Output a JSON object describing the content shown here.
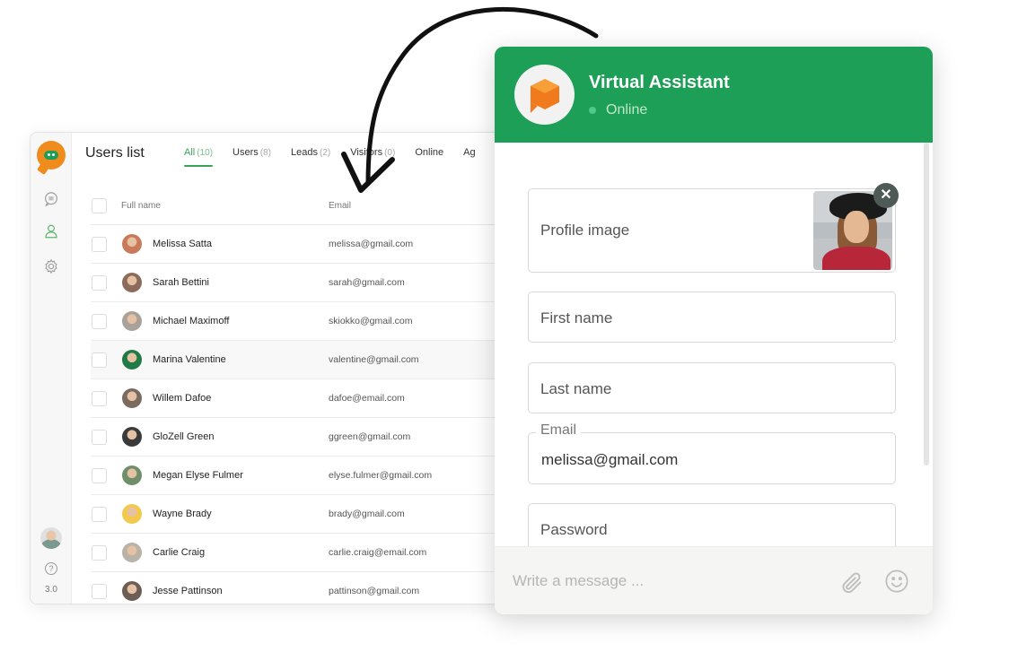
{
  "users_panel": {
    "title": "Users list",
    "version": "3.0",
    "help_glyph": "?",
    "rail_icons": [
      "app-logo-icon",
      "chat-icon",
      "user-icon",
      "gear-icon"
    ],
    "tabs": [
      {
        "label": "All",
        "count": "(10)",
        "active": true
      },
      {
        "label": "Users",
        "count": "(8)",
        "active": false
      },
      {
        "label": "Leads",
        "count": "(2)",
        "active": false
      },
      {
        "label": "Visitors",
        "count": "(0)",
        "active": false
      },
      {
        "label": "Online",
        "count": "",
        "active": false
      },
      {
        "label": "Ag",
        "count": "",
        "active": false
      }
    ],
    "columns": {
      "name": "Full name",
      "email": "Email"
    },
    "rows": [
      {
        "name": "Melissa Satta",
        "email": "melissa@gmail.com",
        "avatar_color": "#c97a5a"
      },
      {
        "name": "Sarah Bettini",
        "email": "sarah@gmail.com",
        "avatar_color": "#8d6b5a"
      },
      {
        "name": "Michael Maximoff",
        "email": "skiokko@gmail.com",
        "avatar_color": "#a8a29a"
      },
      {
        "name": "Marina Valentine",
        "email": "valentine@gmail.com",
        "avatar_color": "#1f7a45"
      },
      {
        "name": "Willem Dafoe",
        "email": "dafoe@email.com",
        "avatar_color": "#7a6a60"
      },
      {
        "name": "GloZell Green",
        "email": "ggreen@gmail.com",
        "avatar_color": "#3a3a3a"
      },
      {
        "name": "Megan Elyse Fulmer",
        "email": "elyse.fulmer@gmail.com",
        "avatar_color": "#6f8f6a"
      },
      {
        "name": "Wayne Brady",
        "email": "brady@gmail.com",
        "avatar_color": "#f2c94c"
      },
      {
        "name": "Carlie Craig",
        "email": "carlie.craig@email.com",
        "avatar_color": "#b9b2a6"
      },
      {
        "name": "Jesse Pattinson",
        "email": "pattinson@gmail.com",
        "avatar_color": "#6d5e55"
      }
    ]
  },
  "chat": {
    "title": "Virtual Assistant",
    "status": "Online",
    "colors": {
      "header": "#1e9f57",
      "status_dot": "#4fc98a",
      "bot_icon": "#f07a1c"
    },
    "fields": {
      "profile_image_label": "Profile image",
      "remove_photo_glyph": "✕",
      "first_name_label": "First name",
      "last_name_label": "Last name",
      "email_label": "Email",
      "email_value": "melissa@gmail.com",
      "password_label": "Password"
    },
    "footer": {
      "message_placeholder": "Write a message ..."
    }
  }
}
